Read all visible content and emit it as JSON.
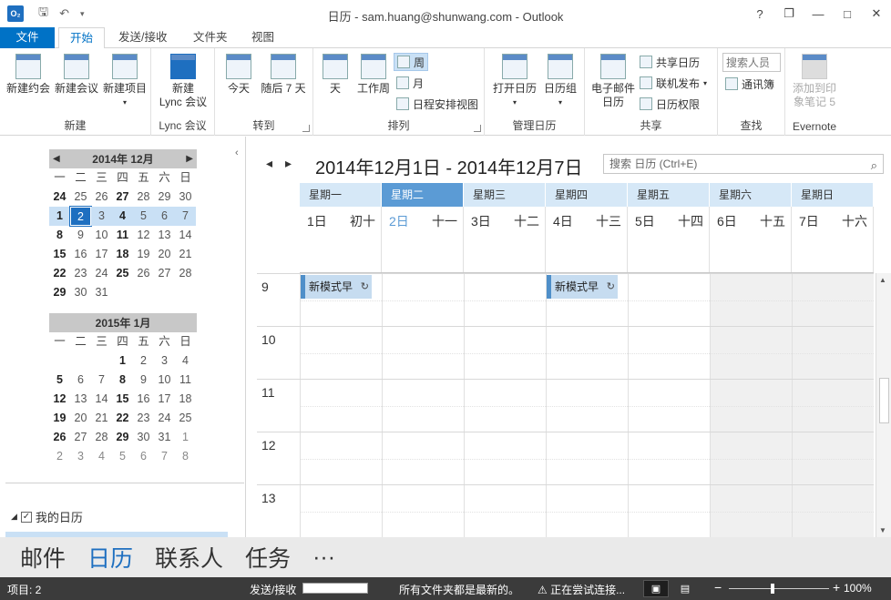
{
  "titlebar": {
    "app_icon": "O₂",
    "title": "日历 - sam.huang@shunwang.com - Outlook",
    "help": "?",
    "restore": "❐",
    "minimize": "—",
    "maximize": "□",
    "close": "✕"
  },
  "tabs": {
    "file": "文件",
    "home": "开始",
    "send_receive": "发送/接收",
    "folder": "文件夹",
    "view": "视图"
  },
  "ribbon": {
    "new_group": "新建",
    "new_appointment": "新建约会",
    "new_meeting": "新建会议",
    "new_items": "新建项目",
    "lync_group": "Lync 会议",
    "new_lync_line1": "新建",
    "new_lync_line2": "Lync 会议",
    "goto_group": "转到",
    "today": "今天",
    "next7": "随后 7 天",
    "arrange_group": "排列",
    "day": "天",
    "workweek": "工作周",
    "week": "周",
    "month": "月",
    "schedule_view": "日程安排视图",
    "manage_group": "管理日历",
    "open_calendar": "打开日历",
    "calendar_groups": "日历组",
    "share_group": "共享",
    "email_calendar_line1": "电子邮件",
    "email_calendar_line2": "日历",
    "share_calendar": "共享日历",
    "publish_online": "联机发布",
    "calendar_permissions": "日历权限",
    "find_group": "查找",
    "search_people_placeholder": "搜索人员",
    "address_book": "通讯簿",
    "evernote_group": "Evernote",
    "evernote_line1": "添加到印",
    "evernote_line2": "象笔记 5"
  },
  "minical_dec": {
    "title": "2014年 12月",
    "weekdays": [
      "一",
      "二",
      "三",
      "四",
      "五",
      "六",
      "日"
    ],
    "weeks": [
      [
        "24",
        "25",
        "26",
        "27",
        "28",
        "29",
        "30"
      ],
      [
        "1",
        "2",
        "3",
        "4",
        "5",
        "6",
        "7"
      ],
      [
        "8",
        "9",
        "10",
        "11",
        "12",
        "13",
        "14"
      ],
      [
        "15",
        "16",
        "17",
        "18",
        "19",
        "20",
        "21"
      ],
      [
        "22",
        "23",
        "24",
        "25",
        "26",
        "27",
        "28"
      ],
      [
        "29",
        "30",
        "31",
        "",
        "",
        "",
        ""
      ]
    ]
  },
  "minical_jan": {
    "title": "2015年 1月",
    "weekdays": [
      "一",
      "二",
      "三",
      "四",
      "五",
      "六",
      "日"
    ],
    "weeks": [
      [
        "",
        "",
        "",
        "1",
        "2",
        "3",
        "4"
      ],
      [
        "5",
        "6",
        "7",
        "8",
        "9",
        "10",
        "11"
      ],
      [
        "12",
        "13",
        "14",
        "15",
        "16",
        "17",
        "18"
      ],
      [
        "19",
        "20",
        "21",
        "22",
        "23",
        "24",
        "25"
      ],
      [
        "26",
        "27",
        "28",
        "29",
        "30",
        "31",
        "1"
      ],
      [
        "2",
        "3",
        "4",
        "5",
        "6",
        "7",
        "8"
      ]
    ]
  },
  "folders": {
    "my_calendars": "我的日历"
  },
  "main": {
    "range_title": "2014年12月1日 - 2014年12月7日",
    "search_placeholder": "搜索 日历 (Ctrl+E)",
    "days": [
      {
        "weekday": "星期一",
        "date": "1日",
        "lunar": "初十"
      },
      {
        "weekday": "星期二",
        "date": "2日",
        "lunar": "十一"
      },
      {
        "weekday": "星期三",
        "date": "3日",
        "lunar": "十二"
      },
      {
        "weekday": "星期四",
        "date": "4日",
        "lunar": "十三"
      },
      {
        "weekday": "星期五",
        "date": "5日",
        "lunar": "十四"
      },
      {
        "weekday": "星期六",
        "date": "6日",
        "lunar": "十五"
      },
      {
        "weekday": "星期日",
        "date": "7日",
        "lunar": "十六"
      }
    ],
    "hours": [
      "9",
      "10",
      "11",
      "12",
      "13"
    ],
    "appointment_1": "新模式早",
    "appointment_2": "新模式早"
  },
  "navbar": {
    "mail": "邮件",
    "calendar": "日历",
    "people": "联系人",
    "tasks": "任务",
    "more": "···"
  },
  "statusbar": {
    "items": "项目: 2",
    "send_receive": "发送/接收",
    "all_folders": "所有文件夹都是最新的。",
    "warning": "⚠ 正在尝试连接...",
    "zoom_minus": "−",
    "zoom_plus": "+",
    "zoom": "100%"
  }
}
